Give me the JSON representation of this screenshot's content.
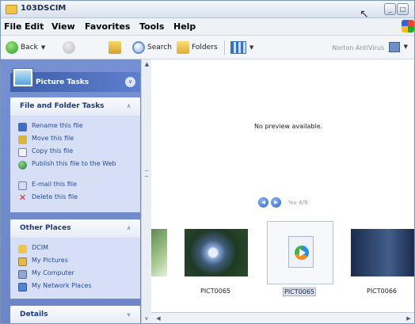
{
  "window": {
    "title": "103DSCIM"
  },
  "menu": [
    "File",
    "Edit",
    "View",
    "Favorites",
    "Tools",
    "Help"
  ],
  "toolbar": {
    "back_label": "Back",
    "search_label": "Search",
    "folders_label": "Folders",
    "address_label": "Norton AntiVirus"
  },
  "left": {
    "picture_tasks": {
      "title": "Picture Tasks"
    },
    "file_folder_tasks": {
      "title": "File and Folder Tasks",
      "items": [
        {
          "label": "Rename this file",
          "icon": "rename-icon"
        },
        {
          "label": "Move this file",
          "icon": "move-icon"
        },
        {
          "label": "Copy this file",
          "icon": "copy-icon"
        },
        {
          "label": "Publish this file to the Web",
          "icon": "publish-web-icon"
        },
        {
          "label": "E-mail this file",
          "icon": "email-icon"
        },
        {
          "label": "Delete this file",
          "icon": "delete-icon"
        }
      ]
    },
    "other_places": {
      "title": "Other Places",
      "items": [
        {
          "label": "DCIM",
          "icon": "folder-icon"
        },
        {
          "label": "My Pictures",
          "icon": "my-pictures-icon"
        },
        {
          "label": "My Computer",
          "icon": "my-computer-icon"
        },
        {
          "label": "My Network Places",
          "icon": "network-places-icon"
        }
      ]
    },
    "details": {
      "title": "Details"
    }
  },
  "preview": {
    "message": "No preview available.",
    "nav_label": "%v 4/9"
  },
  "thumbnails": [
    {
      "caption": ""
    },
    {
      "caption": "PICT0065"
    },
    {
      "caption": "PICT0065"
    },
    {
      "caption": "PICT0066"
    }
  ]
}
